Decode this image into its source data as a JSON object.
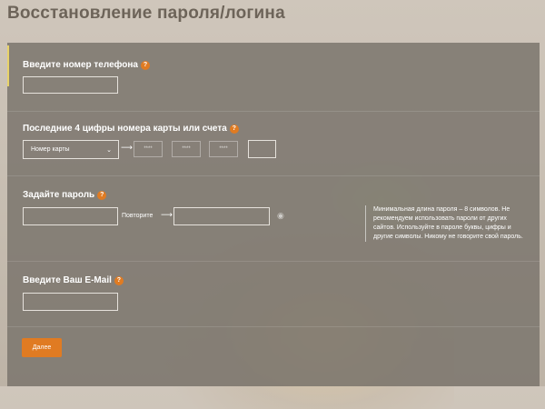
{
  "page_title": "Восстановление пароля/логина",
  "help_icon_glyph": "?",
  "phone": {
    "label": "Введите номер телефона",
    "value": ""
  },
  "card": {
    "label": "Последние 4 цифры номера карты или счета",
    "select_value": "Номер карты",
    "mask": "****"
  },
  "password": {
    "label": "Задайте пароль",
    "repeat_label": "Повторите",
    "hint": "Минимальная длина пароля – 8 символов. Не рекомендуем использовать пароли от других сайтов. Используйте в пароле буквы, цифры и другие символы. Никому не говорите свой пароль."
  },
  "email": {
    "label": "Введите Ваш E-Mail",
    "value": ""
  },
  "submit_label": "Далее",
  "colors": {
    "accent": "#e07b22",
    "panel": "#7b766d",
    "title": "#6d6459"
  }
}
